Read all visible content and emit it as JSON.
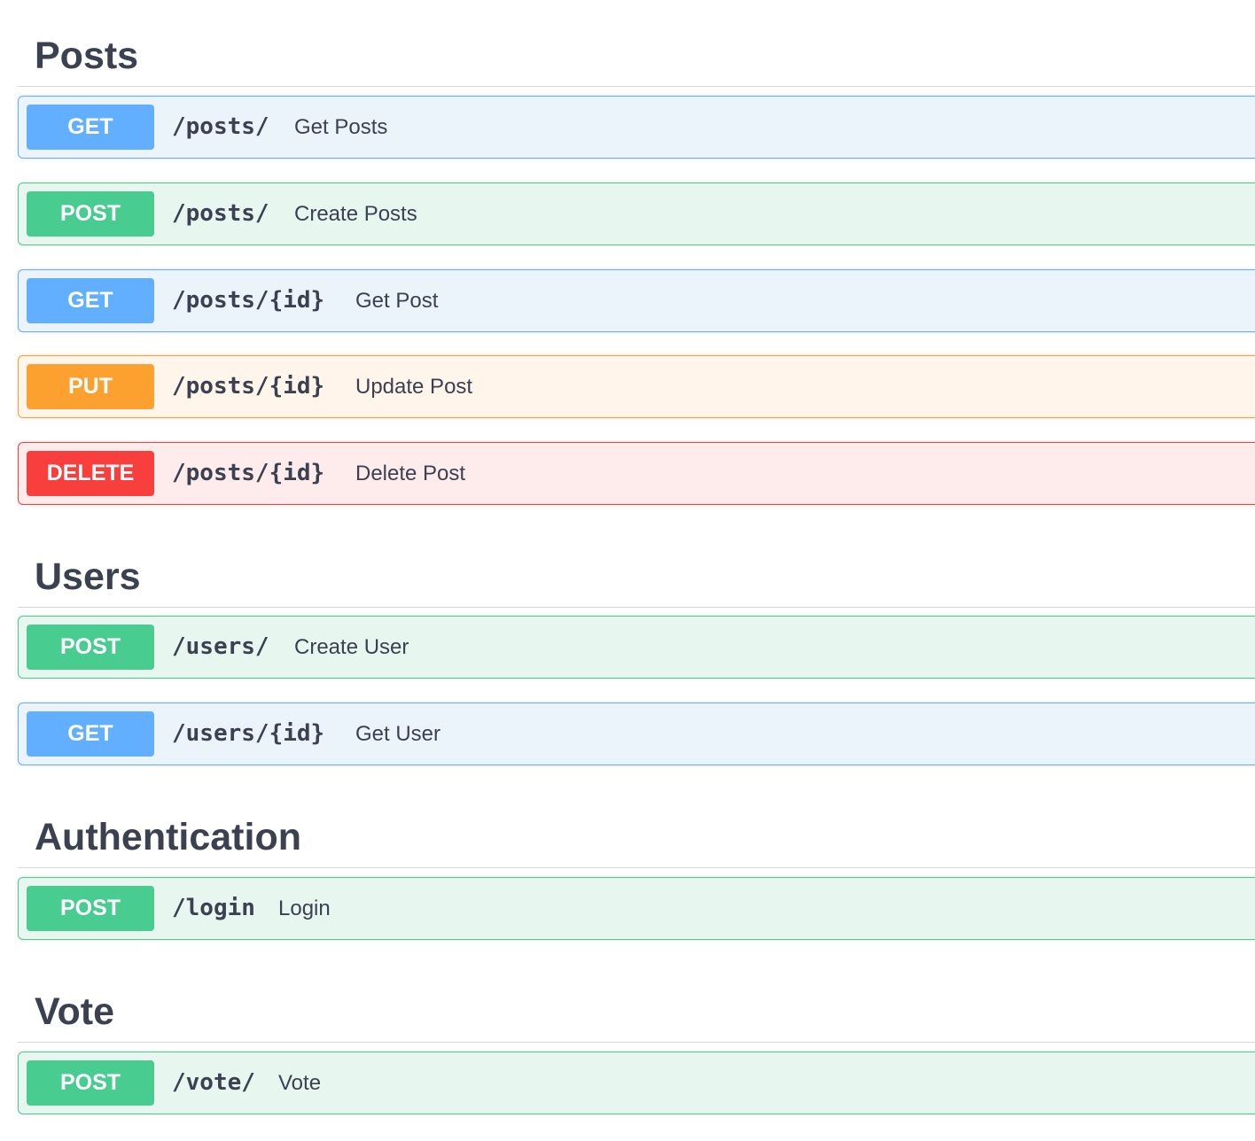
{
  "sections": [
    {
      "title": "Posts",
      "operations": [
        {
          "method": "GET",
          "path": "/posts/",
          "summary": "Get Posts"
        },
        {
          "method": "POST",
          "path": "/posts/",
          "summary": "Create Posts"
        },
        {
          "method": "GET",
          "path": "/posts/{id}",
          "summary": "Get Post"
        },
        {
          "method": "PUT",
          "path": "/posts/{id}",
          "summary": "Update Post"
        },
        {
          "method": "DELETE",
          "path": "/posts/{id}",
          "summary": "Delete Post"
        }
      ]
    },
    {
      "title": "Users",
      "operations": [
        {
          "method": "POST",
          "path": "/users/",
          "summary": "Create User"
        },
        {
          "method": "GET",
          "path": "/users/{id}",
          "summary": "Get User"
        }
      ]
    },
    {
      "title": "Authentication",
      "operations": [
        {
          "method": "POST",
          "path": "/login",
          "summary": "Login"
        }
      ]
    },
    {
      "title": "Vote",
      "operations": [
        {
          "method": "POST",
          "path": "/vote/",
          "summary": "Vote"
        }
      ]
    }
  ],
  "colors": {
    "get": "#61affe",
    "post": "#49cc90",
    "put": "#fca130",
    "delete": "#f93e3e",
    "text": "#3b4151"
  }
}
